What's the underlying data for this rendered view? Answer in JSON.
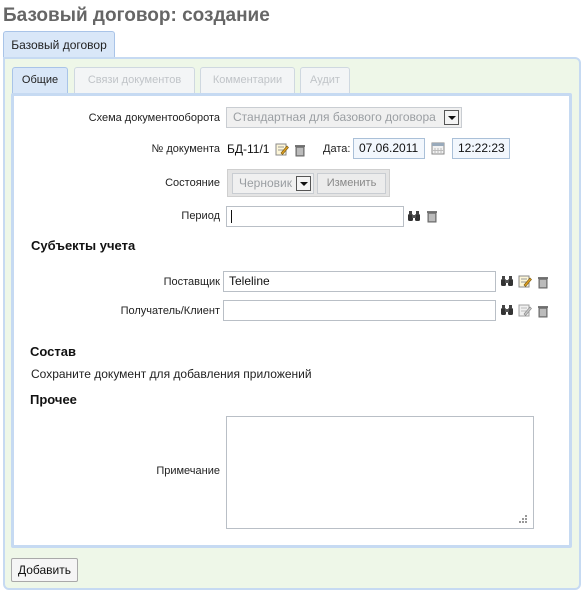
{
  "page": {
    "title": "Базовый договор: создание"
  },
  "outer_tab": {
    "label": "Базовый договор"
  },
  "tabs": [
    {
      "label": "Общие",
      "active": true
    },
    {
      "label": "Связи документов",
      "active": false
    },
    {
      "label": "Комментарии",
      "active": false
    },
    {
      "label": "Аудит",
      "active": false
    }
  ],
  "form": {
    "workflow": {
      "label": "Схема документооборота",
      "value": "Стандартная для базового договора"
    },
    "doc_number": {
      "label": "№ документа",
      "value": "БД-11/1"
    },
    "date": {
      "label": "Дата:",
      "value": "07.06.2011",
      "time": "12:22:23"
    },
    "state": {
      "label": "Состояние",
      "value": "Черновик",
      "change_label": "Изменить"
    },
    "period": {
      "label": "Период",
      "value": ""
    }
  },
  "subjects": {
    "title": "Субъекты учета",
    "supplier": {
      "label": "Поставщик",
      "value": "Teleline"
    },
    "recipient": {
      "label": "Получатель/Клиент",
      "value": ""
    }
  },
  "composition": {
    "title": "Состав",
    "note": "Сохраните документ для добавления приложений"
  },
  "other": {
    "title": "Прочее",
    "note_label": "Примечание",
    "note_value": ""
  },
  "actions": {
    "add_label": "Добавить"
  },
  "colors": {
    "panel_border": "#c6daf2",
    "panel_bg": "#eef7e8",
    "active_tab": "#d9e7f8"
  }
}
